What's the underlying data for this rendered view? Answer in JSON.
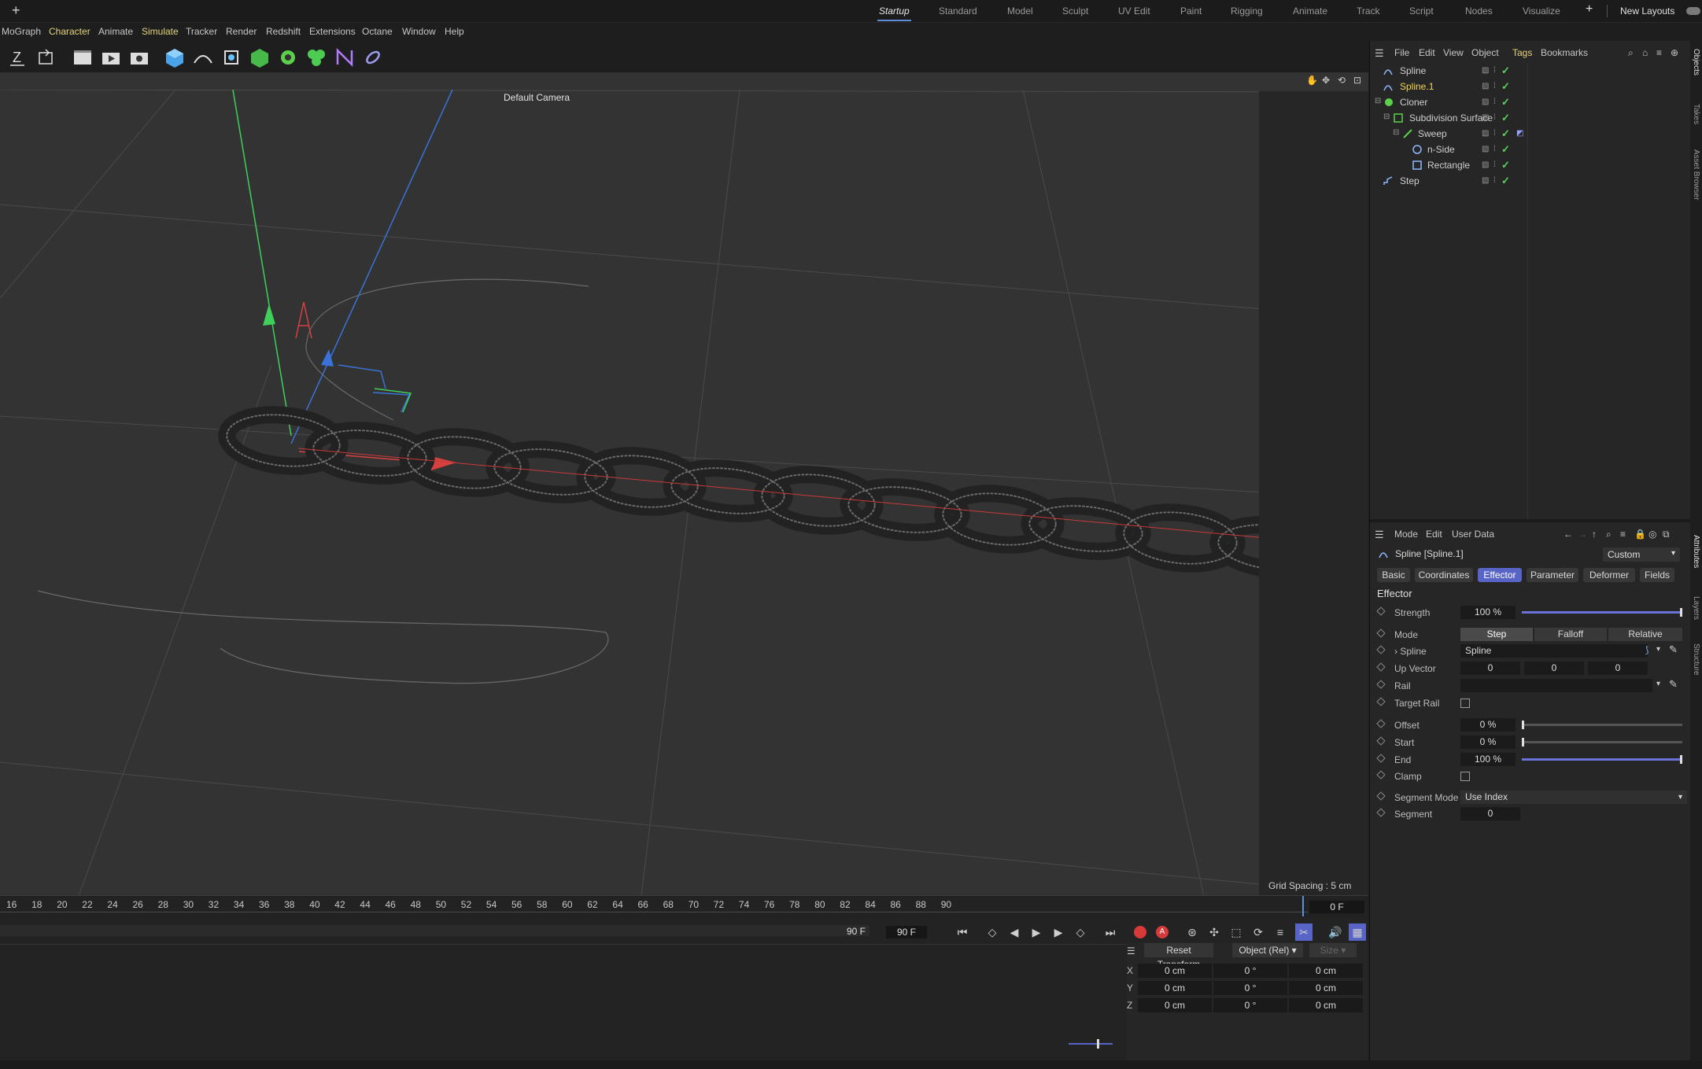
{
  "layouts": {
    "tabs": [
      "Startup",
      "Standard",
      "Model",
      "Sculpt",
      "UV Edit",
      "Paint",
      "Rigging",
      "Animate",
      "Track",
      "Script",
      "Nodes",
      "Visualize"
    ],
    "active": "Startup",
    "new_layouts": "New Layouts"
  },
  "menubar": [
    "MoGraph",
    "Character",
    "Animate",
    "Simulate",
    "Tracker",
    "Render",
    "Redshift",
    "Extensions",
    "Octane",
    "Window",
    "Help"
  ],
  "viewport": {
    "camera": "Default Camera",
    "grid_spacing": "Grid Spacing : 5 cm"
  },
  "timeline": {
    "ticks": [
      "16",
      "18",
      "20",
      "22",
      "24",
      "26",
      "28",
      "30",
      "32",
      "34",
      "36",
      "38",
      "40",
      "42",
      "44",
      "46",
      "48",
      "50",
      "52",
      "54",
      "56",
      "58",
      "60",
      "62",
      "64",
      "66",
      "68",
      "70",
      "72",
      "74",
      "76",
      "78",
      "80",
      "82",
      "84",
      "86",
      "88",
      "90"
    ],
    "current_frame": "0 F",
    "end_frame_a": "90 F",
    "end_frame_b": "90 F"
  },
  "coordinates": {
    "reset_label": "Reset Transform",
    "space": "Object (Rel)",
    "size_label": "Size",
    "rows": [
      {
        "axis": "X",
        "pos": "0 cm",
        "rot": "0 °",
        "size": "0 cm"
      },
      {
        "axis": "Y",
        "pos": "0 cm",
        "rot": "0 °",
        "size": "0 cm"
      },
      {
        "axis": "Z",
        "pos": "0 cm",
        "rot": "0 °",
        "size": "0 cm"
      }
    ]
  },
  "objects_panel": {
    "menu": [
      "File",
      "Edit",
      "View",
      "Object",
      "Tags",
      "Bookmarks"
    ],
    "items": [
      {
        "name": "Spline",
        "selected": false
      },
      {
        "name": "Spline.1",
        "selected": true
      },
      {
        "name": "Cloner",
        "selected": false
      },
      {
        "name": "Subdivision Surface",
        "selected": false
      },
      {
        "name": "Sweep",
        "selected": false
      },
      {
        "name": "n-Side",
        "selected": false
      },
      {
        "name": "Rectangle",
        "selected": false
      },
      {
        "name": "Step",
        "selected": false
      }
    ]
  },
  "side_tabs": [
    "Objects",
    "Takes",
    "Asset Browser",
    "Attributes",
    "Layers",
    "Structure"
  ],
  "attributes": {
    "menu": [
      "Mode",
      "Edit",
      "User Data"
    ],
    "title": "Spline [Spline.1]",
    "preset": "Custom",
    "tabs": [
      "Basic",
      "Coordinates",
      "Effector",
      "Parameter",
      "Deformer",
      "Fields"
    ],
    "active_tab": "Effector",
    "section": "Effector",
    "strength": {
      "label": "Strength",
      "value": "100 %",
      "level": 1.0
    },
    "mode": {
      "label": "Mode",
      "options": [
        "Step",
        "Falloff",
        "Relative"
      ],
      "selected": "Step"
    },
    "spline": {
      "label": "Spline",
      "value": "Spline"
    },
    "up_vector": {
      "label": "Up Vector",
      "values": [
        "0",
        "0",
        "0"
      ]
    },
    "rail": {
      "label": "Rail",
      "value": ""
    },
    "target_rail": {
      "label": "Target Rail",
      "checked": false
    },
    "offset": {
      "label": "Offset",
      "value": "0 %",
      "level": 0.0
    },
    "start": {
      "label": "Start",
      "value": "0 %",
      "level": 0.0
    },
    "end": {
      "label": "End",
      "value": "100 %",
      "level": 1.0
    },
    "clamp": {
      "label": "Clamp",
      "checked": false
    },
    "segment_mode": {
      "label": "Segment Mode",
      "value": "Use Index"
    },
    "segment": {
      "label": "Segment",
      "value": "0"
    }
  },
  "colors": {
    "accent": "#5864c6",
    "selected_text": "#f0d458",
    "check": "#5fd05f"
  }
}
